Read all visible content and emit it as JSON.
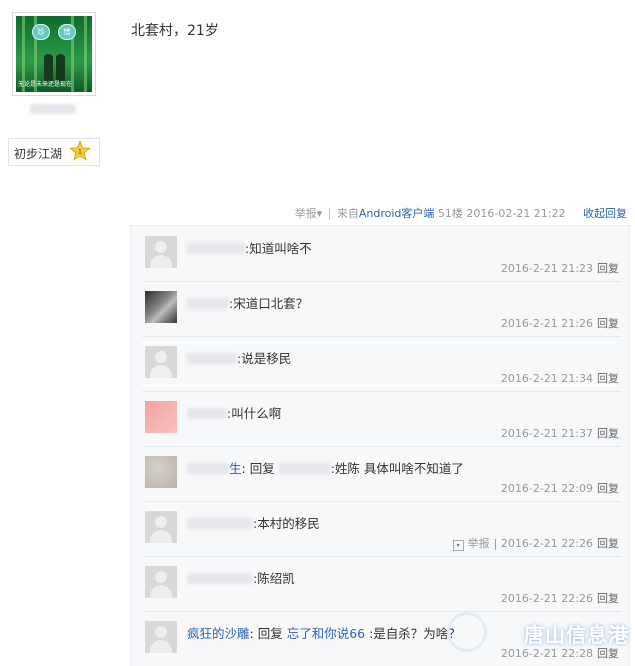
{
  "user": {
    "avatar_text": "无论是未来还是现在",
    "heart_left": "珍",
    "heart_right": "惜",
    "rank": "初步江湖",
    "rank_level": "1"
  },
  "post": {
    "content": "北套村，21岁",
    "report": "举报",
    "report_arrow": "▾",
    "separator": "|",
    "source_prefix": "来自",
    "source_client": "Android客户端",
    "floor": "51楼",
    "time": "2016-02-21 21:22",
    "collapse": "收起回复"
  },
  "comments": [
    {
      "user": "",
      "reply_to": "",
      "text": ":知道叫啥不",
      "time": "2016-2-21 21:23",
      "reply": "回复"
    },
    {
      "user": "",
      "reply_to": "",
      "text": ":宋道口北套？",
      "time": "2016-2-21 21:26",
      "reply": "回复"
    },
    {
      "user": "",
      "reply_to": "",
      "text": ":说是移民",
      "time": "2016-2-21 21:34",
      "reply": "回复"
    },
    {
      "user": "",
      "reply_to": "",
      "text": ":叫什么啊",
      "time": "2016-2-21 21:37",
      "reply": "回复"
    },
    {
      "user": "",
      "reply_to": "",
      "user_suffix": "生",
      "reply_word": "回复",
      "text": ":姓陈 具体叫啥不知道了",
      "time": "2016-2-21 22:09",
      "reply": "回复"
    },
    {
      "user": "",
      "reply_to": "",
      "text": ":本村的移民",
      "time": "2016-2-21 22:26",
      "report": "举报",
      "report_arrow": "▾",
      "reply": "回复"
    },
    {
      "user": "",
      "reply_to": "",
      "text": ":陈绍凯",
      "time": "2016-2-21 22:26",
      "reply": "回复"
    },
    {
      "user": "疯狂的沙雕",
      "reply_word": "回复",
      "reply_to": "忘了和你说66",
      "text": ":是自杀？为啥？",
      "time": "2016-2-21 22:28",
      "reply": "回复"
    }
  ],
  "watermark": "唐山信息港",
  "colors": {
    "link": "#2d64b3",
    "meta": "#999999",
    "panel": "#f7f8fa"
  }
}
